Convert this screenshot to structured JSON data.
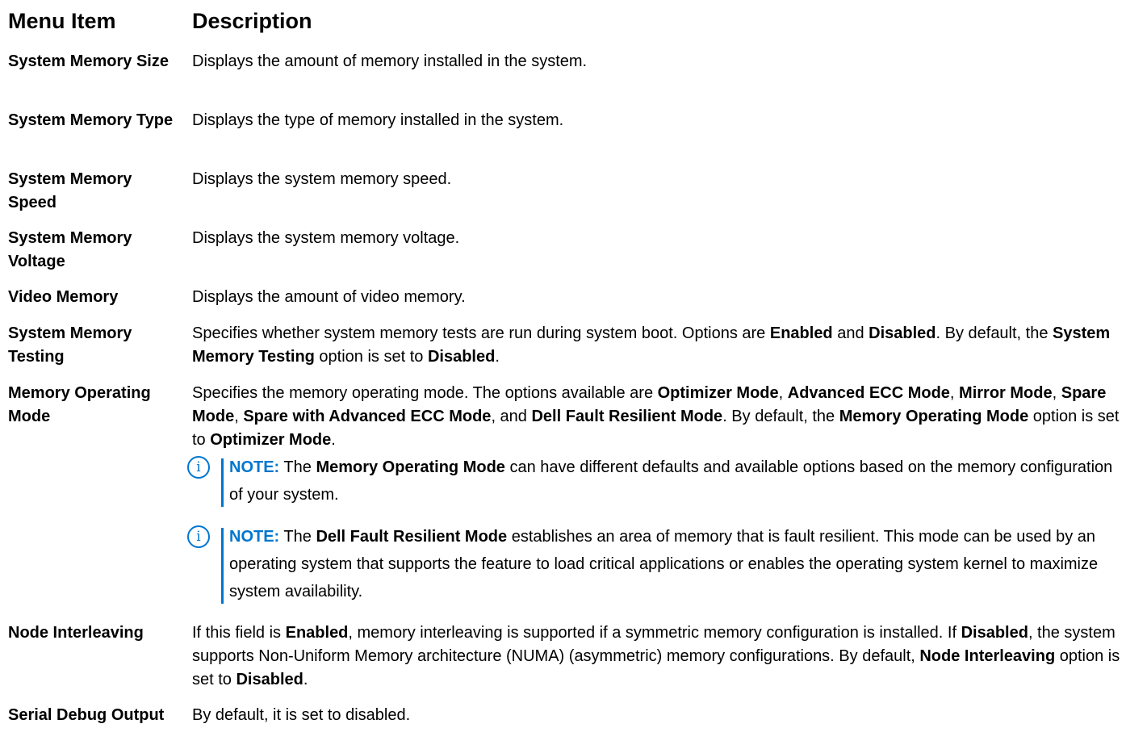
{
  "header": {
    "col_item": "Menu Item",
    "col_desc": "Description"
  },
  "rows": [
    {
      "item": "System Memory Size",
      "desc": [
        {
          "t": "Displays the amount of memory installed in the system."
        }
      ]
    },
    {
      "item": "System Memory Type",
      "desc": [
        {
          "t": "Displays the type of memory installed in the system."
        }
      ]
    },
    {
      "item": "System Memory Speed",
      "desc": [
        {
          "t": "Displays the system memory speed."
        }
      ]
    },
    {
      "item": "System Memory Voltage",
      "desc": [
        {
          "t": "Displays the system memory voltage."
        }
      ]
    },
    {
      "item": "Video Memory",
      "desc": [
        {
          "t": "Displays the amount of video memory."
        }
      ]
    },
    {
      "item": "System Memory Testing",
      "desc": [
        {
          "t": "Specifies whether system memory tests are run during system boot. Options are "
        },
        {
          "t": "Enabled",
          "b": true
        },
        {
          "t": " and "
        },
        {
          "t": "Disabled",
          "b": true
        },
        {
          "t": ". By default, the "
        },
        {
          "t": "System Memory Testing",
          "b": true
        },
        {
          "t": " option is set to "
        },
        {
          "t": "Disabled",
          "b": true
        },
        {
          "t": "."
        }
      ]
    },
    {
      "item": "Memory Operating Mode",
      "desc": [
        {
          "t": "Specifies the memory operating mode. The options available are "
        },
        {
          "t": "Optimizer Mode",
          "b": true
        },
        {
          "t": ", "
        },
        {
          "t": "Advanced ECC Mode",
          "b": true
        },
        {
          "t": ", "
        },
        {
          "t": "Mirror Mode",
          "b": true
        },
        {
          "t": ", "
        },
        {
          "t": "Spare Mode",
          "b": true
        },
        {
          "t": ", "
        },
        {
          "t": "Spare with Advanced ECC Mode",
          "b": true
        },
        {
          "t": ", and "
        },
        {
          "t": "Dell Fault Resilient Mode",
          "b": true
        },
        {
          "t": ". By default, the "
        },
        {
          "t": "Memory Operating Mode",
          "b": true
        },
        {
          "t": " option is set to "
        },
        {
          "t": "Optimizer Mode",
          "b": true
        },
        {
          "t": "."
        }
      ],
      "notes": [
        {
          "label": "NOTE:",
          "icon": "info-icon",
          "text": [
            {
              "t": " The "
            },
            {
              "t": "Memory Operating Mode",
              "b": true
            },
            {
              "t": " can have different defaults and available options based on the memory configuration of your system."
            }
          ]
        },
        {
          "label": "NOTE:",
          "icon": "info-icon",
          "text": [
            {
              "t": " The "
            },
            {
              "t": "Dell Fault Resilient Mode",
              "b": true
            },
            {
              "t": " establishes an area of memory that is fault resilient. This mode can be used by an operating system that supports the feature to load critical applications or enables the operating system kernel to maximize system availability."
            }
          ]
        }
      ]
    },
    {
      "item": "Node Interleaving",
      "desc": [
        {
          "t": "If this field is "
        },
        {
          "t": "Enabled",
          "b": true
        },
        {
          "t": ", memory interleaving is supported if a symmetric memory configuration is installed. If "
        },
        {
          "t": "Disabled",
          "b": true
        },
        {
          "t": ", the system supports Non-Uniform Memory architecture (NUMA) (asymmetric) memory configurations. By default, "
        },
        {
          "t": "Node Interleaving",
          "b": true
        },
        {
          "t": " option is set to "
        },
        {
          "t": "Disabled",
          "b": true
        },
        {
          "t": "."
        }
      ]
    },
    {
      "item": "Serial Debug Output",
      "desc": [
        {
          "t": "By default, it is set to disabled."
        }
      ]
    }
  ],
  "colors": {
    "note_accent": "#0076ce",
    "text": "#000000"
  }
}
